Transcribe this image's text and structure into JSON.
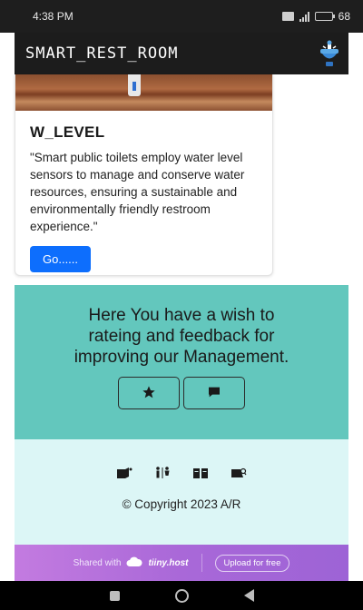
{
  "status_bar": {
    "time": "4:38 PM",
    "battery": "68"
  },
  "app_bar": {
    "title": "SMART_REST_ROOM",
    "logo_icon": "toilet-logo-icon"
  },
  "card": {
    "title": "W_LEVEL",
    "text": "\"Smart public toilets employ water level sensors to manage and conserve water resources, ensuring a sustainable and environmentally friendly restroom experience.\"",
    "button_label": "Go......"
  },
  "feedback": {
    "text": "Here You have a wish to rateing and feedback for improving our Management.",
    "buttons": [
      {
        "icon": "star-icon"
      },
      {
        "icon": "chat-icon"
      }
    ]
  },
  "footer": {
    "icons": [
      "restroom-sign-icon",
      "people-icon",
      "book-icon",
      "no-camera-icon"
    ],
    "copyright": "© Copyright 2023 A/R"
  },
  "shared_bar": {
    "shared_with": "Shared with",
    "brand": "tiiny.host",
    "upload_label": "Upload for free"
  },
  "colors": {
    "primary_button": "#0d6efd",
    "feedback_bg": "#63c7bd",
    "footer_bg": "#dcf6f6",
    "app_bar_bg": "#1c1c1c"
  }
}
